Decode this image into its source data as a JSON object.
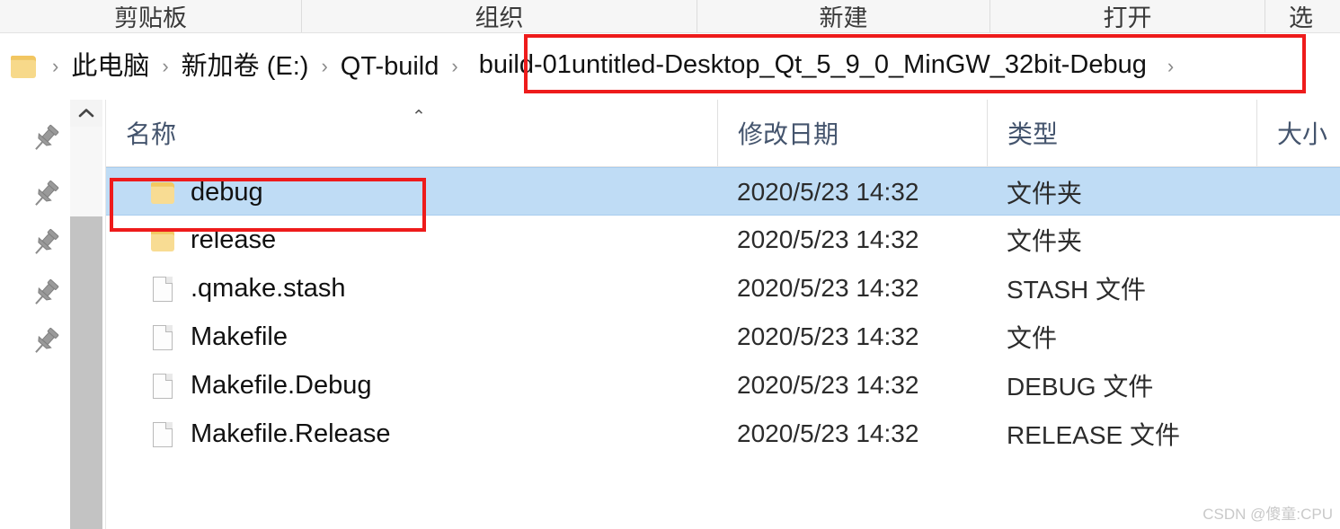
{
  "ribbon": {
    "groups": [
      {
        "label": "剪贴板",
        "name": "clipboard"
      },
      {
        "label": "组织",
        "name": "organize"
      },
      {
        "label": "新建",
        "name": "new"
      },
      {
        "label": "打开",
        "name": "open"
      },
      {
        "label": "选",
        "name": "select"
      }
    ]
  },
  "address": {
    "folder_icon": "folder-icon",
    "separator": "›",
    "crumbs": [
      {
        "label": "此电脑",
        "name": "this-pc"
      },
      {
        "label": "新加卷 (E:)",
        "name": "new-volume-e"
      },
      {
        "label": "QT-build",
        "name": "qt-build"
      },
      {
        "label": "build-01untitled-Desktop_Qt_5_9_0_MinGW_32bit-Debug",
        "name": "build-folder"
      }
    ]
  },
  "navpane": {
    "pin_icon": "pin-icon",
    "pin_count": 5
  },
  "scrollbar": {
    "up_arrow": "chevron-up-icon"
  },
  "filelist": {
    "columns": [
      {
        "label": "名称",
        "name": "name"
      },
      {
        "label": "修改日期",
        "name": "date-modified"
      },
      {
        "label": "类型",
        "name": "type"
      },
      {
        "label": "大小",
        "name": "size"
      }
    ],
    "sort_indicator": "⌃",
    "rows": [
      {
        "name": "debug",
        "date": "2020/5/23 14:32",
        "type": "文件夹",
        "size": "",
        "icon": "folder-icon",
        "selected": true
      },
      {
        "name": "release",
        "date": "2020/5/23 14:32",
        "type": "文件夹",
        "size": "",
        "icon": "folder-icon",
        "selected": false
      },
      {
        "name": ".qmake.stash",
        "date": "2020/5/23 14:32",
        "type": "STASH 文件",
        "size": "",
        "icon": "file-icon",
        "selected": false
      },
      {
        "name": "Makefile",
        "date": "2020/5/23 14:32",
        "type": "文件",
        "size": "",
        "icon": "file-icon",
        "selected": false
      },
      {
        "name": "Makefile.Debug",
        "date": "2020/5/23 14:32",
        "type": "DEBUG 文件",
        "size": "",
        "icon": "file-icon",
        "selected": false
      },
      {
        "name": "Makefile.Release",
        "date": "2020/5/23 14:32",
        "type": "RELEASE 文件",
        "size": "",
        "icon": "file-icon",
        "selected": false
      }
    ]
  },
  "annotations": {
    "color": "#ee1b1b",
    "address_box": "build-01untitled-Desktop_Qt_5_9_0_MinGW_32bit-Debug",
    "row_box": "debug"
  },
  "watermark": {
    "text": "CSDN @傻童:CPU"
  }
}
